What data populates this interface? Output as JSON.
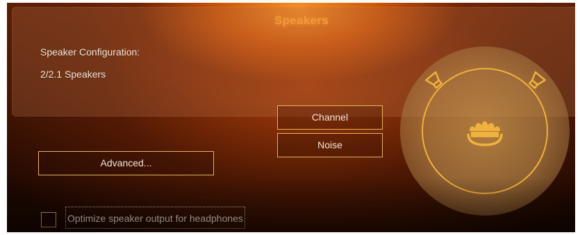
{
  "window": {
    "title": "Speakers"
  },
  "speaker_config": {
    "label": "Speaker Configuration:",
    "value": "2/2.1 Speakers"
  },
  "buttons": {
    "channel": "Channel",
    "noise": "Noise",
    "advanced": "Advanced..."
  },
  "optimize": {
    "label": "Optimize speaker output for headphones",
    "checked": false
  },
  "visual": {
    "icons": [
      "left-speaker-icon",
      "right-speaker-icon",
      "listener-icon"
    ],
    "accent_color": "#f0b23c",
    "title_color": "#f29a3a"
  }
}
